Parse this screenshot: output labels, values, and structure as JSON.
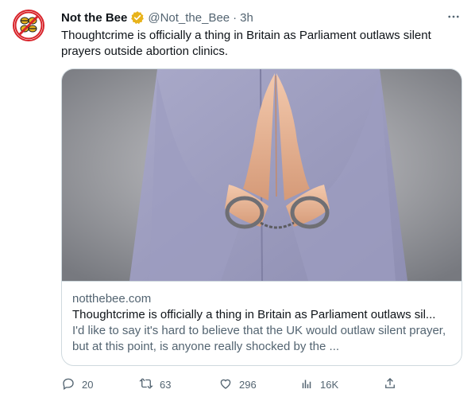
{
  "tweet": {
    "author_name": "Not the Bee",
    "author_handle": "@Not_the_Bee",
    "separator": "·",
    "time": "3h",
    "text": "Thoughtcrime is officially a thing in Britain as Parliament outlaws silent prayers outside abortion clinics.",
    "icons": {
      "more": "more-icon",
      "verified": "verified-badge-icon"
    },
    "colors": {
      "verified_badge": "#e8b31b",
      "brand_red": "#d8232a",
      "secondary_text": "#536471",
      "border": "#cfd9de"
    }
  },
  "card": {
    "domain": "notthebee.com",
    "title": "Thoughtcrime is officially a thing in Britain as Parliament outlaws sil...",
    "description": "I'd like to say it's hard to believe that the UK would outlaw silent prayer, but at this point, is anyone really shocked by the ..."
  },
  "actions": {
    "replies": "20",
    "retweets": "63",
    "likes": "296",
    "views": "16K",
    "icons": [
      "reply-icon",
      "retweet-icon",
      "like-icon",
      "views-icon",
      "share-icon"
    ]
  }
}
